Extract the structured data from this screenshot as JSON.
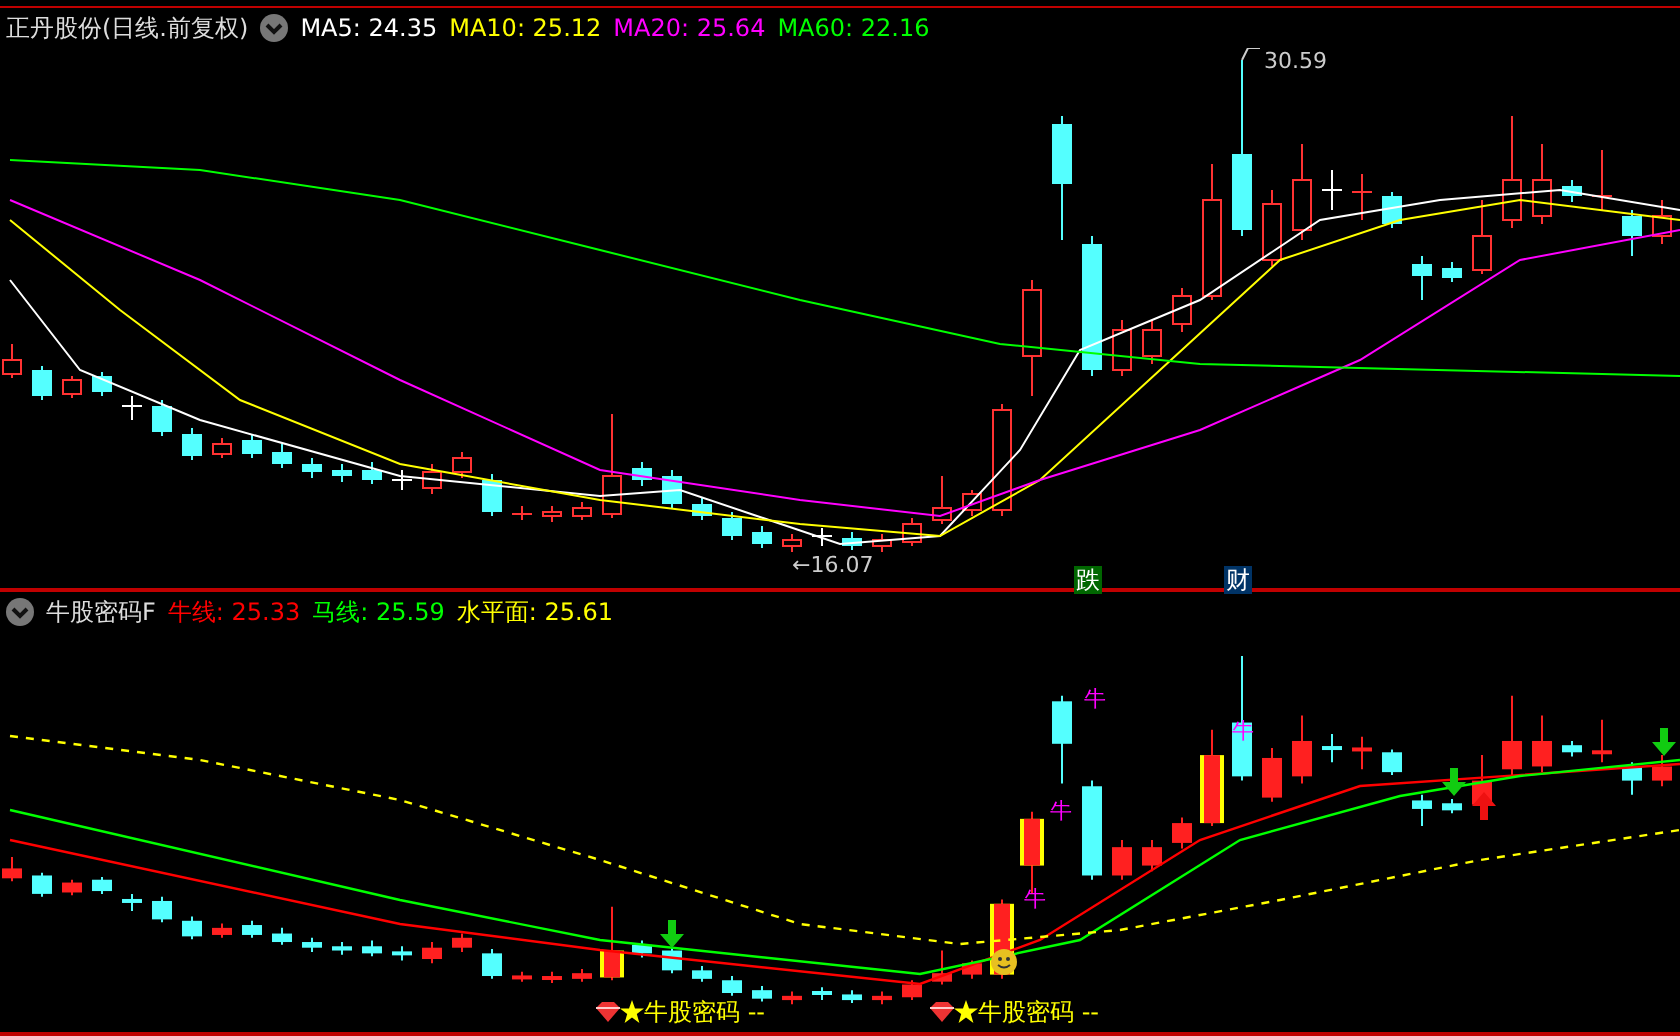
{
  "main_panel": {
    "title": "正丹股份(日线.前复权)",
    "indicators": [
      {
        "label": "MA5: 24.35",
        "color": "#ffffff"
      },
      {
        "label": "MA10: 25.12",
        "color": "#ffff00"
      },
      {
        "label": "MA20: 25.64",
        "color": "#ff00ff"
      },
      {
        "label": "MA60: 22.16",
        "color": "#00ff00"
      }
    ],
    "high_label": "30.59",
    "low_label": "←16.07",
    "event_markers": [
      {
        "text": "跌",
        "color": "#006600"
      },
      {
        "text": "财",
        "color": "#003366"
      }
    ]
  },
  "indicator_panel": {
    "title": "牛股密码F",
    "indicators": [
      {
        "label": "牛线: 25.33",
        "color": "#ff0000"
      },
      {
        "label": "马线: 25.59",
        "color": "#00ff00"
      },
      {
        "label": "水平面: 25.61",
        "color": "#ffff00"
      }
    ],
    "signal_labels": [
      "牛股密码 --",
      "牛股密码 --"
    ],
    "bull_markers": [
      "牛",
      "牛",
      "牛",
      "牛"
    ]
  }
}
